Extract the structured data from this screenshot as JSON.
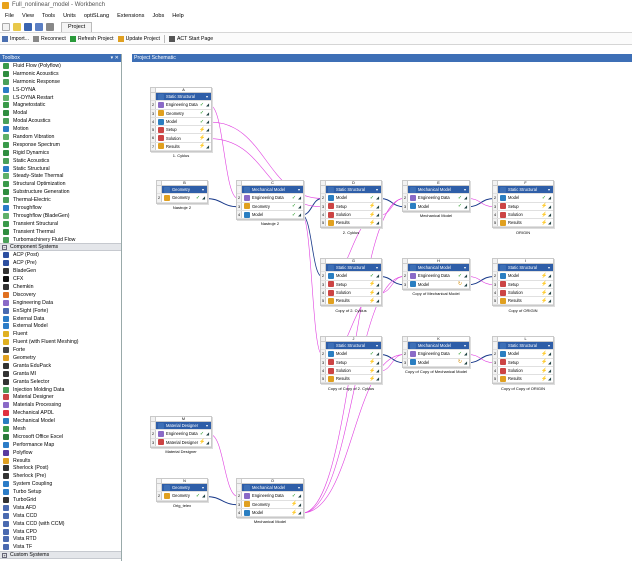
{
  "window": {
    "title": "Full_nonlinear_model - Workbench"
  },
  "menu": [
    "File",
    "View",
    "Tools",
    "Units",
    "optiSLang",
    "Extensions",
    "Jobs",
    "Help"
  ],
  "tab": "Project",
  "toolbar": [
    {
      "label": "Import...",
      "icon": "import-icon"
    },
    {
      "label": "Reconnect",
      "icon": "reconnect-icon"
    },
    {
      "label": "Refresh Project",
      "icon": "refresh-icon"
    },
    {
      "label": "Update Project",
      "icon": "update-icon"
    },
    {
      "label": "ACT Start Page",
      "icon": "act-icon"
    }
  ],
  "toolbox": {
    "title": "Toolbox",
    "analysis_items": [
      "Fluid Flow (Polyflow)",
      "Harmonic Acoustics",
      "Harmonic Response",
      "LS-DYNA",
      "LS-DYNA Restart",
      "Magnetostatic",
      "Modal",
      "Modal Acoustics",
      "Motion",
      "Random Vibration",
      "Response Spectrum",
      "Rigid Dynamics",
      "Static Acoustics",
      "Static Structural",
      "Steady-State Thermal",
      "Structural Optimization",
      "Substructure Generation",
      "Thermal-Electric",
      "Throughflow",
      "Throughflow (BladeGen)",
      "Transient Structural",
      "Transient Thermal",
      "Turbomachinery Fluid Flow"
    ],
    "component_header": "Component Systems",
    "component_items": [
      "ACP (Post)",
      "ACP (Pre)",
      "BladeGen",
      "CFX",
      "Chemkin",
      "Discovery",
      "Engineering Data",
      "EnSight (Forte)",
      "External Data",
      "External Model",
      "Fluent",
      "Fluent (with Fluent Meshing)",
      "Forte",
      "Geometry",
      "Granta EduPack",
      "Granta MI",
      "Granta Selector",
      "Injection Molding Data",
      "Material Designer",
      "Materials Processing",
      "Mechanical APDL",
      "Mechanical Model",
      "Mesh",
      "Microsoft Office Excel",
      "Performance Map",
      "Polyflow",
      "Results",
      "Sherlock (Post)",
      "Sherlock (Pre)",
      "System Coupling",
      "Turbo Setup",
      "TurboGrid",
      "Vista AFD",
      "Vista CCD",
      "Vista CCD (with CCM)",
      "Vista CPD",
      "Vista RTD",
      "Vista TF"
    ],
    "custom_header": "Custom Systems"
  },
  "schematic": {
    "title": "Project Schematic",
    "systems": [
      {
        "id": "A",
        "rows": [
          {
            "n": "1",
            "t": "Static Structural",
            "ic": "#3d6fb6"
          },
          {
            "n": "2",
            "t": "Engineering Data",
            "ic": "#8a6ac7",
            "s": "✓"
          },
          {
            "n": "3",
            "t": "Geometry",
            "ic": "#e0a020",
            "s": "✓"
          },
          {
            "n": "4",
            "t": "Model",
            "ic": "#2a7ec1",
            "s": "✓"
          },
          {
            "n": "5",
            "t": "Setup",
            "ic": "#c44",
            "s": "⚡"
          },
          {
            "n": "6",
            "t": "Solution",
            "ic": "#c44",
            "s": "⚡"
          },
          {
            "n": "7",
            "t": "Results",
            "ic": "#e0a020",
            "s": "⚡"
          }
        ],
        "caption": "1. Cyklus"
      },
      {
        "id": "B",
        "rows": [
          {
            "n": "1",
            "t": "Geometry",
            "ic": "#3d6fb6"
          },
          {
            "n": "2",
            "t": "Geometry",
            "ic": "#e0a020",
            "s": "✓"
          }
        ],
        "caption": "Nastroje 2"
      },
      {
        "id": "C",
        "rows": [
          {
            "n": "1",
            "t": "Mechanical Model",
            "ic": "#3d6fb6"
          },
          {
            "n": "2",
            "t": "Engineering Data",
            "ic": "#8a6ac7",
            "s": "✓"
          },
          {
            "n": "3",
            "t": "Geometry",
            "ic": "#e0a020",
            "s": "✓"
          },
          {
            "n": "4",
            "t": "Model",
            "ic": "#2a7ec1",
            "s": "✓"
          }
        ],
        "caption": "Nastroje 2"
      },
      {
        "id": "D",
        "rows": [
          {
            "n": "1",
            "t": "Static Structural",
            "ic": "#3d6fb6"
          },
          {
            "n": "2",
            "t": "Model",
            "ic": "#2a7ec1",
            "s": "✓"
          },
          {
            "n": "3",
            "t": "Setup",
            "ic": "#c44",
            "s": "⚡"
          },
          {
            "n": "4",
            "t": "Solution",
            "ic": "#c44",
            "s": "⚡"
          },
          {
            "n": "5",
            "t": "Results",
            "ic": "#e0a020",
            "s": "⚡"
          }
        ],
        "caption": "2. Cyklus"
      },
      {
        "id": "E",
        "rows": [
          {
            "n": "1",
            "t": "Mechanical Model",
            "ic": "#3d6fb6"
          },
          {
            "n": "2",
            "t": "Engineering Data",
            "ic": "#8a6ac7",
            "s": "✓"
          },
          {
            "n": "3",
            "t": "Model",
            "ic": "#2a7ec1",
            "s": "✓"
          }
        ],
        "caption": "Mechanical Model"
      },
      {
        "id": "F",
        "rows": [
          {
            "n": "1",
            "t": "Static Structural",
            "ic": "#3d6fb6"
          },
          {
            "n": "2",
            "t": "Model",
            "ic": "#2a7ec1",
            "s": "✓"
          },
          {
            "n": "3",
            "t": "Setup",
            "ic": "#c44",
            "s": "⚡"
          },
          {
            "n": "4",
            "t": "Solution",
            "ic": "#c44",
            "s": "⚡"
          },
          {
            "n": "5",
            "t": "Results",
            "ic": "#e0a020",
            "s": "⚡"
          }
        ],
        "caption": "ORIGIN"
      },
      {
        "id": "G",
        "rows": [
          {
            "n": "1",
            "t": "Static Structural",
            "ic": "#3d6fb6"
          },
          {
            "n": "2",
            "t": "Model",
            "ic": "#2a7ec1",
            "s": "✓"
          },
          {
            "n": "3",
            "t": "Setup",
            "ic": "#c44",
            "s": "⚡"
          },
          {
            "n": "4",
            "t": "Solution",
            "ic": "#c44",
            "s": "⚡"
          },
          {
            "n": "5",
            "t": "Results",
            "ic": "#e0a020",
            "s": "⚡"
          }
        ],
        "caption": "Copy of 2. Cyklus"
      },
      {
        "id": "H",
        "rows": [
          {
            "n": "1",
            "t": "Mechanical Model",
            "ic": "#3d6fb6"
          },
          {
            "n": "2",
            "t": "Engineering Data",
            "ic": "#8a6ac7",
            "s": "✓"
          },
          {
            "n": "3",
            "t": "Model",
            "ic": "#2a7ec1",
            "s": "↻"
          }
        ],
        "caption": "Copy of Mechanical Model"
      },
      {
        "id": "I",
        "rows": [
          {
            "n": "1",
            "t": "Static Structural",
            "ic": "#3d6fb6"
          },
          {
            "n": "2",
            "t": "Model",
            "ic": "#2a7ec1",
            "s": "⚡"
          },
          {
            "n": "3",
            "t": "Setup",
            "ic": "#c44",
            "s": "⚡"
          },
          {
            "n": "4",
            "t": "Solution",
            "ic": "#c44",
            "s": "⚡"
          },
          {
            "n": "5",
            "t": "Results",
            "ic": "#e0a020",
            "s": "⚡"
          }
        ],
        "caption": "Copy of ORIGIN"
      },
      {
        "id": "J",
        "rows": [
          {
            "n": "1",
            "t": "Static Structural",
            "ic": "#3d6fb6"
          },
          {
            "n": "2",
            "t": "Model",
            "ic": "#2a7ec1",
            "s": "✓"
          },
          {
            "n": "3",
            "t": "Setup",
            "ic": "#c44",
            "s": "⚡"
          },
          {
            "n": "4",
            "t": "Solution",
            "ic": "#c44",
            "s": "⚡"
          },
          {
            "n": "5",
            "t": "Results",
            "ic": "#e0a020",
            "s": "⚡"
          }
        ],
        "caption": "Copy of Copy of 2. Cyklus"
      },
      {
        "id": "K",
        "rows": [
          {
            "n": "1",
            "t": "Mechanical Model",
            "ic": "#3d6fb6"
          },
          {
            "n": "2",
            "t": "Engineering Data",
            "ic": "#8a6ac7",
            "s": "✓"
          },
          {
            "n": "3",
            "t": "Model",
            "ic": "#2a7ec1",
            "s": "↻"
          }
        ],
        "caption": "Copy of Copy of Mechanical Model"
      },
      {
        "id": "L",
        "rows": [
          {
            "n": "1",
            "t": "Static Structural",
            "ic": "#3d6fb6"
          },
          {
            "n": "2",
            "t": "Model",
            "ic": "#2a7ec1",
            "s": "⚡"
          },
          {
            "n": "3",
            "t": "Setup",
            "ic": "#c44",
            "s": "⚡"
          },
          {
            "n": "4",
            "t": "Solution",
            "ic": "#c44",
            "s": "⚡"
          },
          {
            "n": "5",
            "t": "Results",
            "ic": "#e0a020",
            "s": "⚡"
          }
        ],
        "caption": "Copy of Copy of ORIGIN"
      },
      {
        "id": "M",
        "rows": [
          {
            "n": "1",
            "t": "Material Designer",
            "ic": "#3d6fb6"
          },
          {
            "n": "2",
            "t": "Engineering Data",
            "ic": "#8a6ac7",
            "s": "✓"
          },
          {
            "n": "3",
            "t": "Material Designer",
            "ic": "#c44",
            "s": "⚡"
          }
        ],
        "caption": "Material Designer"
      },
      {
        "id": "N",
        "rows": [
          {
            "n": "1",
            "t": "Geometry",
            "ic": "#3d6fb6"
          },
          {
            "n": "2",
            "t": "Geometry",
            "ic": "#e0a020",
            "s": "✓"
          }
        ],
        "caption": "Orig_telex"
      },
      {
        "id": "O",
        "rows": [
          {
            "n": "1",
            "t": "Mechanical Model",
            "ic": "#3d6fb6"
          },
          {
            "n": "2",
            "t": "Engineering Data",
            "ic": "#8a6ac7",
            "s": "✓"
          },
          {
            "n": "3",
            "t": "Geometry",
            "ic": "#e0a020",
            "s": "⚡"
          },
          {
            "n": "4",
            "t": "Model",
            "ic": "#2a7ec1",
            "s": "⚡"
          }
        ],
        "caption": "Mechanical Model"
      }
    ]
  },
  "colors": {
    "link_magenta": "#e040e0",
    "link_blue": "#1a3a8a",
    "header_blue": "#2e5ea8"
  }
}
